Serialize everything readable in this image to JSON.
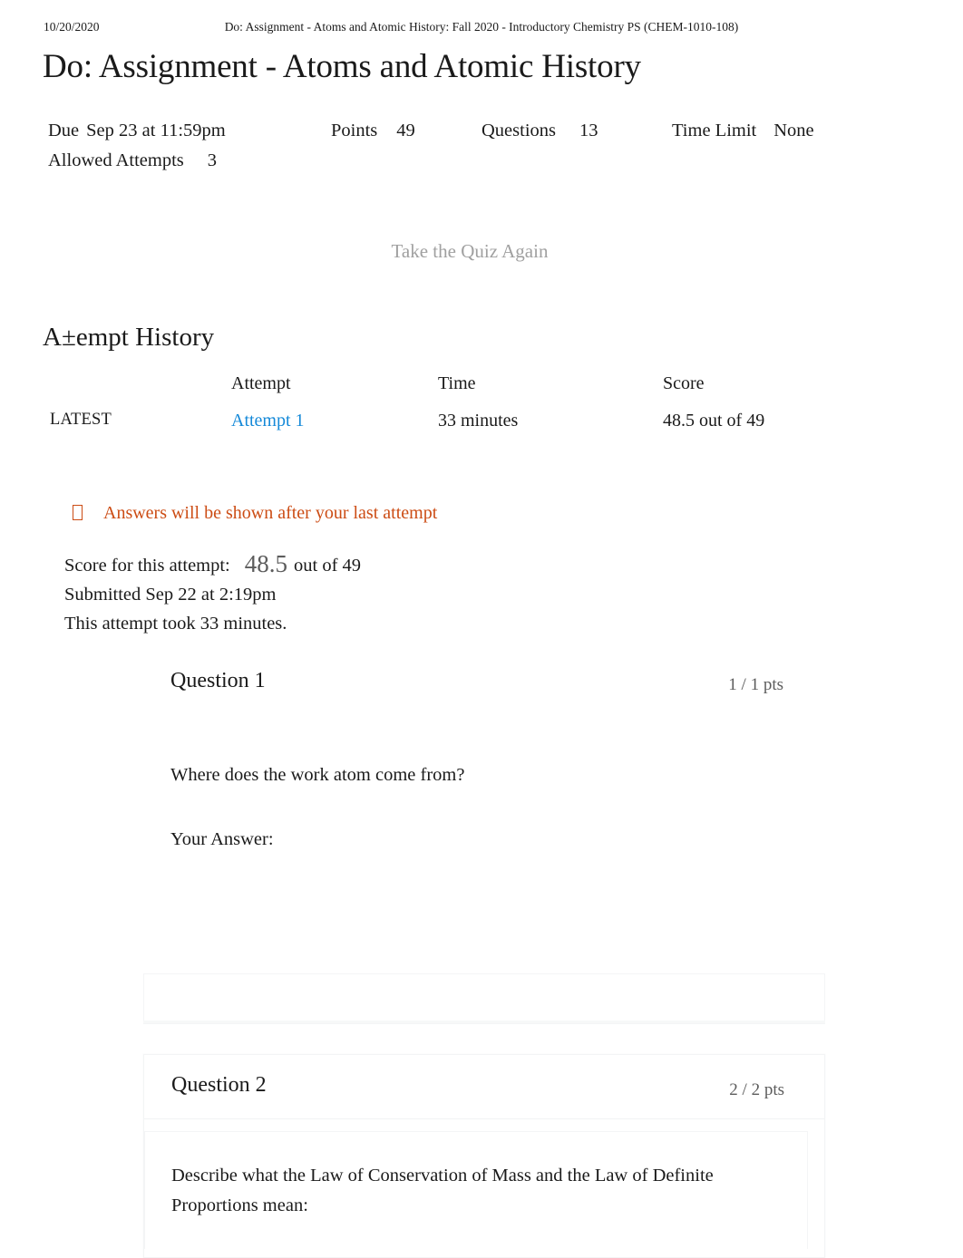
{
  "print_header": {
    "date": "10/20/2020",
    "document_title": "Do: Assignment - Atoms and Atomic History: Fall 2020 - Introductory Chemistry PS (CHEM-1010-108)"
  },
  "page_title": "Do: Assignment - Atoms and Atomic History",
  "quiz_meta": {
    "due_label": "Due",
    "due_value": "Sep 23 at 11:59pm",
    "points_label": "Points",
    "points_value": "49",
    "questions_label": "Questions",
    "questions_value": "13",
    "time_limit_label": "Time Limit",
    "time_limit_value": "None",
    "allowed_attempts_label": "Allowed Attempts",
    "allowed_attempts_value": "3"
  },
  "take_quiz_again": "Take the Quiz Again",
  "attempt_history": {
    "heading": "A±empt History",
    "columns": [
      "",
      "Attempt",
      "Time",
      "Score"
    ],
    "rows": [
      {
        "marker": "LATEST",
        "attempt": "Attempt 1",
        "time": "33 minutes",
        "score": "48.5 out of 49"
      }
    ]
  },
  "answers_notice": {
    "icon": "info-circle-icon",
    "text": "Answers will be shown after your last attempt",
    "color": "#cc4c14"
  },
  "attempt_score": {
    "label": "Score for this attempt:",
    "value": "48.5",
    "out_of": "out of 49",
    "submitted": "Submitted Sep 22 at 2:19pm",
    "duration": "This attempt took 33 minutes."
  },
  "link_color": "#1589d8",
  "questions": [
    {
      "name": "Question 1",
      "points": "1 / 1 pts",
      "text": "Where does the work atom come from?",
      "your_answer_label": "Your Answer:"
    },
    {
      "name": "Question 2",
      "points": "2 / 2 pts",
      "text": "Describe what the Law of Conservation of Mass and the Law of Definite Proportions mean:"
    }
  ]
}
